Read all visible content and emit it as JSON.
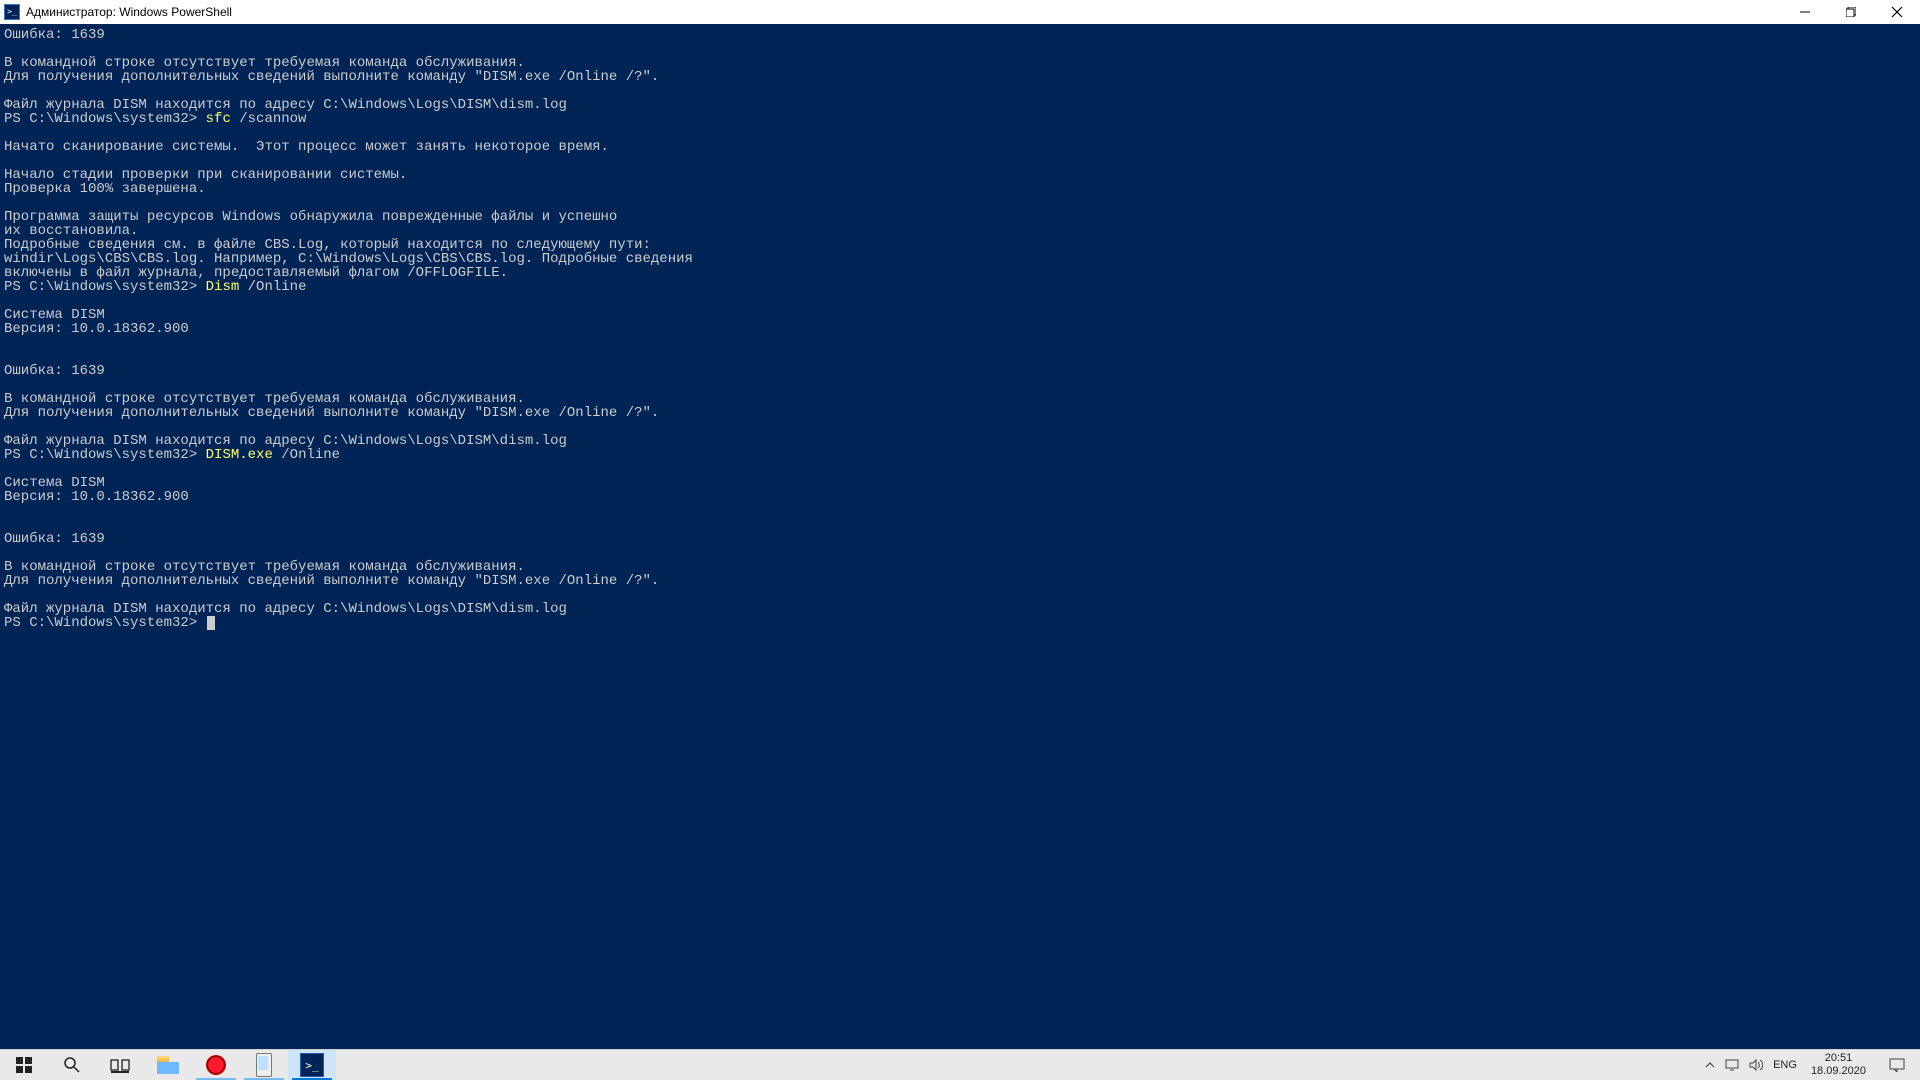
{
  "titlebar": {
    "title": "Администратор: Windows PowerShell"
  },
  "terminal": {
    "lines": [
      {
        "segs": [
          {
            "t": "Ошибка: 1639"
          }
        ]
      },
      {
        "segs": [
          {
            "t": ""
          }
        ]
      },
      {
        "segs": [
          {
            "t": "В командной строке отсутствует требуемая команда обслуживания."
          }
        ]
      },
      {
        "segs": [
          {
            "t": "Для получения дополнительных сведений выполните команду \"DISM.exe /Online /?\"."
          }
        ]
      },
      {
        "segs": [
          {
            "t": ""
          }
        ]
      },
      {
        "segs": [
          {
            "t": "Файл журнала DISM находится по адресу C:\\Windows\\Logs\\DISM\\dism.log"
          }
        ]
      },
      {
        "segs": [
          {
            "t": "PS C:\\Windows\\system32> "
          },
          {
            "t": "sfc ",
            "c": "hl"
          },
          {
            "t": "/scannow"
          }
        ]
      },
      {
        "segs": [
          {
            "t": ""
          }
        ]
      },
      {
        "segs": [
          {
            "t": "Начато сканирование системы.  Этот процесс может занять некоторое время."
          }
        ]
      },
      {
        "segs": [
          {
            "t": ""
          }
        ]
      },
      {
        "segs": [
          {
            "t": "Начало стадии проверки при сканировании системы."
          }
        ]
      },
      {
        "segs": [
          {
            "t": "Проверка 100% завершена."
          }
        ]
      },
      {
        "segs": [
          {
            "t": ""
          }
        ]
      },
      {
        "segs": [
          {
            "t": "Программа защиты ресурсов Windows обнаружила поврежденные файлы и успешно"
          }
        ]
      },
      {
        "segs": [
          {
            "t": "их восстановила."
          }
        ]
      },
      {
        "segs": [
          {
            "t": "Подробные сведения см. в файле CBS.Log, который находится по следующему пути:"
          }
        ]
      },
      {
        "segs": [
          {
            "t": "windir\\Logs\\CBS\\CBS.log. Например, C:\\Windows\\Logs\\CBS\\CBS.log. Подробные сведения"
          }
        ]
      },
      {
        "segs": [
          {
            "t": "включены в файл журнала, предоставляемый флагом /OFFLOGFILE."
          }
        ]
      },
      {
        "segs": [
          {
            "t": "PS C:\\Windows\\system32> "
          },
          {
            "t": "Dism ",
            "c": "hl"
          },
          {
            "t": "/Online"
          }
        ]
      },
      {
        "segs": [
          {
            "t": ""
          }
        ]
      },
      {
        "segs": [
          {
            "t": "Cистема DISM"
          }
        ]
      },
      {
        "segs": [
          {
            "t": "Версия: 10.0.18362.900"
          }
        ]
      },
      {
        "segs": [
          {
            "t": ""
          }
        ]
      },
      {
        "segs": [
          {
            "t": ""
          }
        ]
      },
      {
        "segs": [
          {
            "t": "Ошибка: 1639"
          }
        ]
      },
      {
        "segs": [
          {
            "t": ""
          }
        ]
      },
      {
        "segs": [
          {
            "t": "В командной строке отсутствует требуемая команда обслуживания."
          }
        ]
      },
      {
        "segs": [
          {
            "t": "Для получения дополнительных сведений выполните команду \"DISM.exe /Online /?\"."
          }
        ]
      },
      {
        "segs": [
          {
            "t": ""
          }
        ]
      },
      {
        "segs": [
          {
            "t": "Файл журнала DISM находится по адресу C:\\Windows\\Logs\\DISM\\dism.log"
          }
        ]
      },
      {
        "segs": [
          {
            "t": "PS C:\\Windows\\system32> "
          },
          {
            "t": "DISM.exe ",
            "c": "hl"
          },
          {
            "t": "/Online"
          }
        ]
      },
      {
        "segs": [
          {
            "t": ""
          }
        ]
      },
      {
        "segs": [
          {
            "t": "Cистема DISM"
          }
        ]
      },
      {
        "segs": [
          {
            "t": "Версия: 10.0.18362.900"
          }
        ]
      },
      {
        "segs": [
          {
            "t": ""
          }
        ]
      },
      {
        "segs": [
          {
            "t": ""
          }
        ]
      },
      {
        "segs": [
          {
            "t": "Ошибка: 1639"
          }
        ]
      },
      {
        "segs": [
          {
            "t": ""
          }
        ]
      },
      {
        "segs": [
          {
            "t": "В командной строке отсутствует требуемая команда обслуживания."
          }
        ]
      },
      {
        "segs": [
          {
            "t": "Для получения дополнительных сведений выполните команду \"DISM.exe /Online /?\"."
          }
        ]
      },
      {
        "segs": [
          {
            "t": ""
          }
        ]
      },
      {
        "segs": [
          {
            "t": "Файл журнала DISM находится по адресу C:\\Windows\\Logs\\DISM\\dism.log"
          }
        ]
      },
      {
        "segs": [
          {
            "t": "PS C:\\Windows\\system32> "
          }
        ],
        "cursor": true
      }
    ]
  },
  "taskbar": {
    "apps": [
      {
        "name": "start-button",
        "kind": "start"
      },
      {
        "name": "search-button",
        "kind": "search"
      },
      {
        "name": "task-view-button",
        "kind": "taskview"
      },
      {
        "name": "file-explorer",
        "kind": "explorer",
        "running": false
      },
      {
        "name": "opera-browser",
        "kind": "opera",
        "running": true
      },
      {
        "name": "your-phone",
        "kind": "phone",
        "running": true
      },
      {
        "name": "powershell",
        "kind": "ps",
        "running": true,
        "active": true
      }
    ],
    "tray": {
      "lang": "ENG",
      "time": "20:51",
      "date": "18.09.2020"
    }
  }
}
